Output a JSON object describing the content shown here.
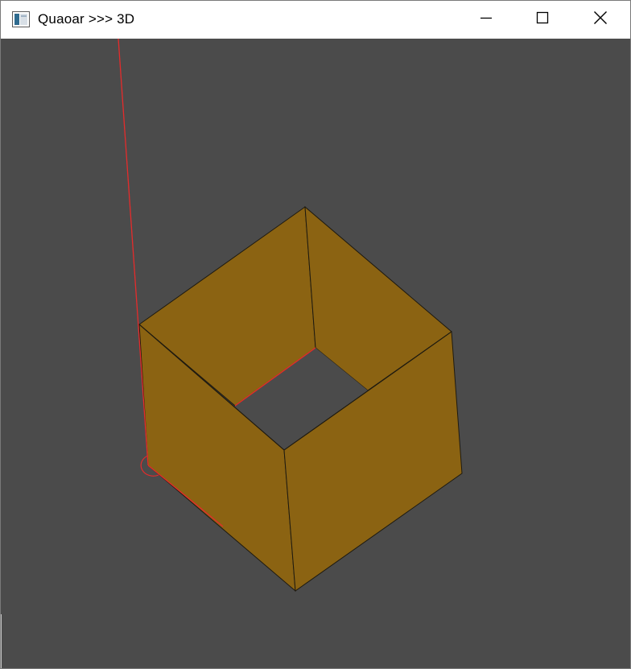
{
  "window": {
    "title": "Quaoar >>> 3D",
    "icon": "app-window-icon",
    "controls": {
      "minimize_icon": "minimize-icon",
      "maximize_icon": "maximize-icon",
      "close_icon": "close-icon"
    }
  },
  "viewport": {
    "background_color": "#4b4b4b",
    "shape": "hollow square tube (box without top and bottom faces)",
    "face_color": "#8b6312",
    "edge_color": "#1e1a10",
    "highlight_color": "#e52b2b"
  }
}
